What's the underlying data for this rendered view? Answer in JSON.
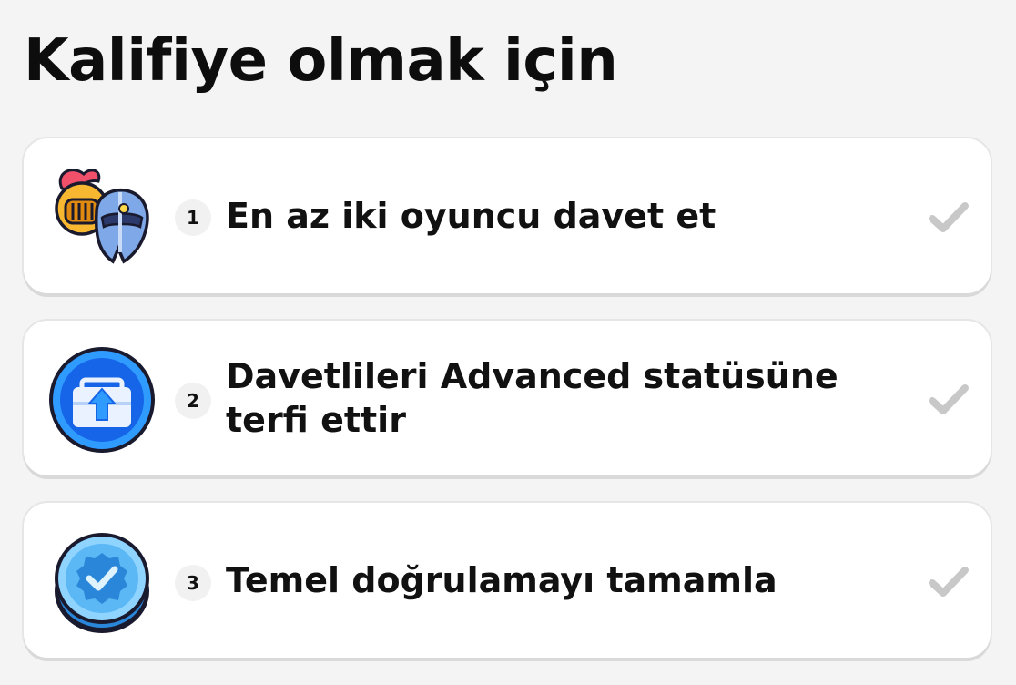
{
  "title": "Kalifiye olmak için",
  "steps": [
    {
      "number": "1",
      "text": "En az iki oyuncu davet et",
      "icon": "knight-helmets-icon",
      "completed": false
    },
    {
      "number": "2",
      "text": "Davetlileri Advanced statüsüne terfi ettir",
      "icon": "upgrade-briefcase-icon",
      "completed": false
    },
    {
      "number": "3",
      "text": "Temel doğrulamayı tamamla",
      "icon": "verified-badge-icon",
      "completed": false
    }
  ],
  "colors": {
    "background": "#f4f4f4",
    "card": "#ffffff",
    "check_inactive": "#c8c8c8"
  }
}
